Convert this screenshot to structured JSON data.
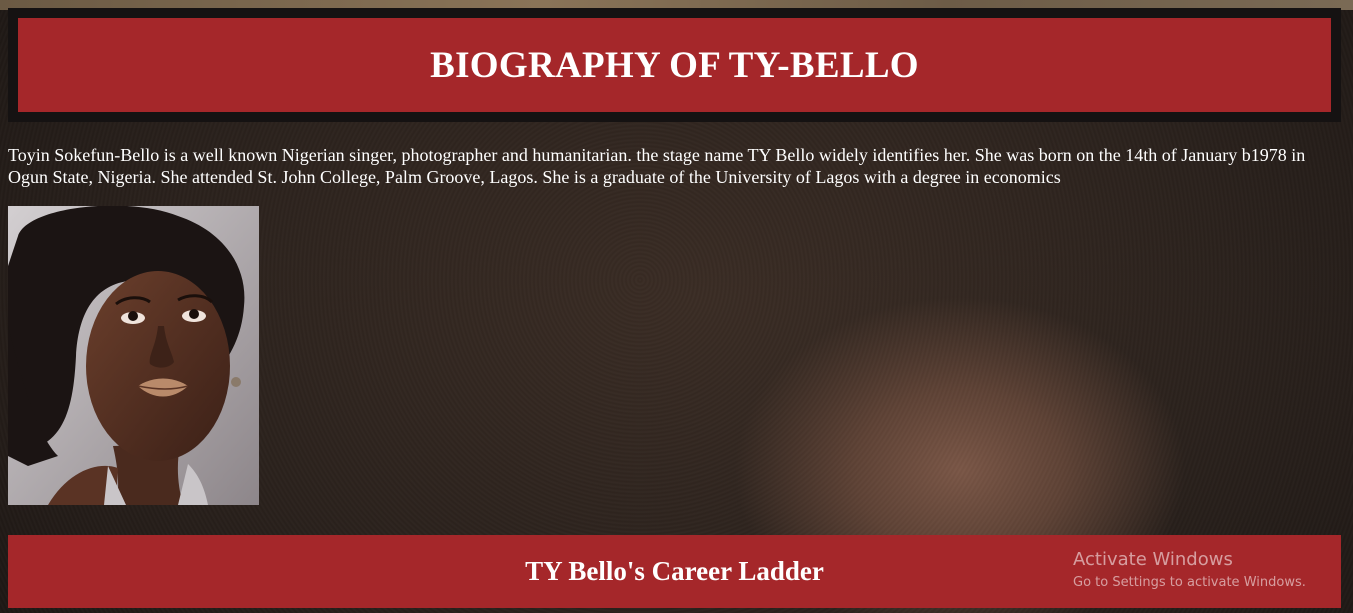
{
  "header": {
    "title": "BIOGRAPHY OF TY-BELLO"
  },
  "intro": {
    "text": "Toyin Sokefun-Bello is a well known Nigerian singer, photographer and humanitarian. the stage name TY Bello widely identifies her. She was born on the 14th of January b1978 in Ogun State, Nigeria. She attended St. John College, Palm Groove, Lagos. She is a graduate of the University of Lagos with a degree in economics"
  },
  "portrait": {
    "alt": "portrait of TY Bello"
  },
  "career": {
    "title": "TY Bello's Career Ladder"
  },
  "watermark": {
    "title": "Activate Windows",
    "subtitle": "Go to Settings to activate Windows."
  },
  "colors": {
    "accent_red": "#a5272a",
    "header_frame": "#151212",
    "text": "#ffffff"
  }
}
